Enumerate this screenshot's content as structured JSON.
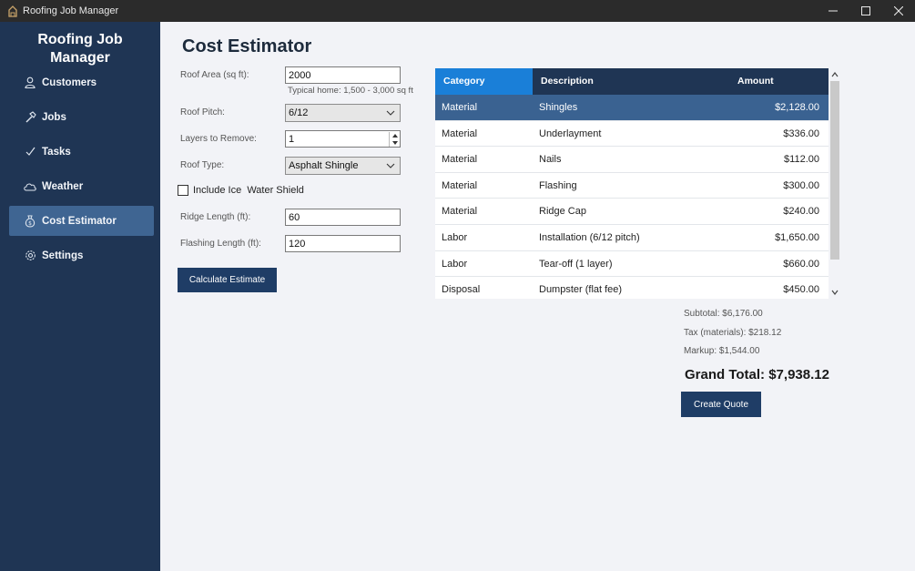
{
  "window": {
    "title": "Roofing Job Manager"
  },
  "sidebar": {
    "brand_line1": "Roofing Job",
    "brand_line2": "Manager",
    "items": [
      {
        "label": "Customers",
        "icon": "person-icon"
      },
      {
        "label": "Jobs",
        "icon": "hammer-icon"
      },
      {
        "label": "Tasks",
        "icon": "checkmark-icon"
      },
      {
        "label": "Weather",
        "icon": "cloud-icon"
      },
      {
        "label": "Cost Estimator",
        "icon": "money-bag-icon",
        "active": true
      },
      {
        "label": "Settings",
        "icon": "gear-icon"
      }
    ]
  },
  "estimator": {
    "title": "Cost Estimator",
    "roof_area_label": "Roof Area (sq ft):",
    "roof_area_value": "2000",
    "roof_area_hint": "Typical home: 1,500 - 3,000 sq ft",
    "roof_pitch_label": "Roof Pitch:",
    "roof_pitch_value": "6/12",
    "layers_label": "Layers to Remove:",
    "layers_value": "1",
    "roof_type_label": "Roof Type:",
    "roof_type_value": "Asphalt Shingle",
    "ice_shield_label": "Include Ice  Water Shield",
    "ice_shield_checked": false,
    "ridge_label": "Ridge Length (ft):",
    "ridge_value": "60",
    "flashing_label": "Flashing Length (ft):",
    "flashing_value": "120",
    "calculate_label": "Calculate Estimate"
  },
  "table": {
    "headers": [
      "Category",
      "Description",
      "Amount"
    ],
    "rows": [
      {
        "category": "Material",
        "description": "Shingles",
        "amount": "$2,128.00"
      },
      {
        "category": "Material",
        "description": "Underlayment",
        "amount": "$336.00"
      },
      {
        "category": "Material",
        "description": "Nails",
        "amount": "$112.00"
      },
      {
        "category": "Material",
        "description": "Flashing",
        "amount": "$300.00"
      },
      {
        "category": "Material",
        "description": "Ridge Cap",
        "amount": "$240.00"
      },
      {
        "category": "Labor",
        "description": "Installation (6/12 pitch)",
        "amount": "$1,650.00"
      },
      {
        "category": "Labor",
        "description": "Tear-off (1 layer)",
        "amount": "$660.00"
      },
      {
        "category": "Disposal",
        "description": "Dumpster (flat fee)",
        "amount": "$450.00"
      }
    ],
    "selected_row": 0
  },
  "summary": {
    "subtotal": "Subtotal: $6,176.00",
    "tax": "Tax (materials): $218.12",
    "markup": "Markup: $1,544.00",
    "grand_total": "Grand Total: $7,938.12",
    "create_quote_label": "Create Quote"
  },
  "colors": {
    "sidebar_bg": "#1f3554",
    "sidebar_active": "#3f6592",
    "header_accent": "#1a7fd8",
    "button_bg": "#1f3d66"
  }
}
